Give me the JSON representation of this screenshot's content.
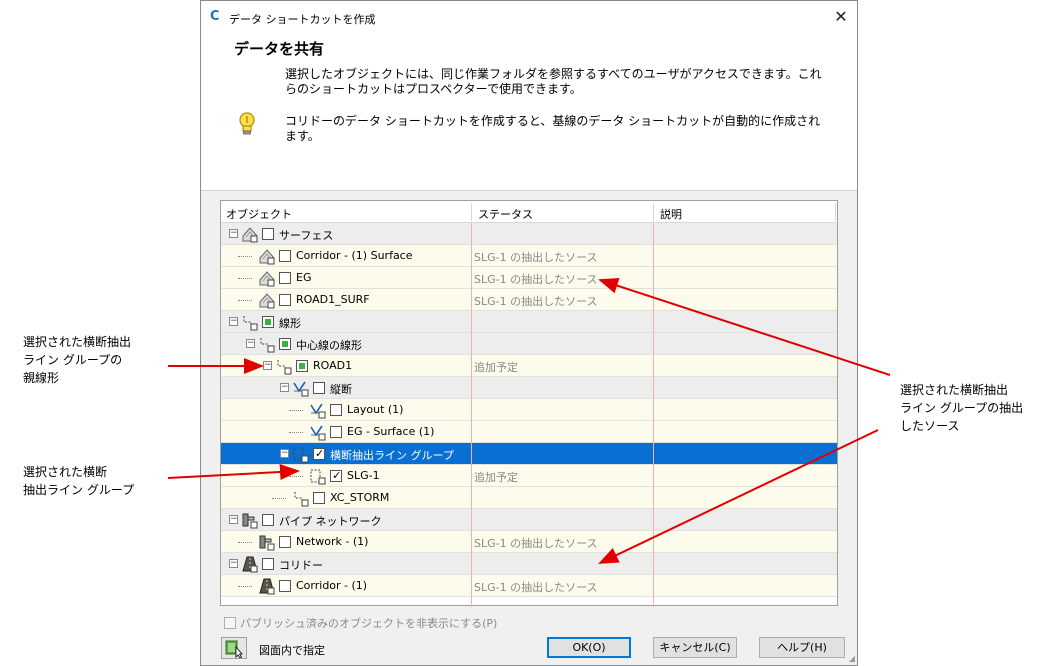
{
  "dialog": {
    "title": "データ ショートカットを作成",
    "close_glyph": "✕",
    "app_glyph": "C",
    "heading": "データを共有",
    "description": "選択したオブジェクトには、同じ作業フォルダを参照するすべてのユーザがアクセスできます。これらのショートカットはプロスペクターで使用できます。",
    "note": "コリドーのデータ ショートカットを作成すると、基線のデータ ショートカットが自動的に作成されます。",
    "icon": "lightbulb-icon"
  },
  "columns": [
    "オブジェクト",
    "ステータス",
    "説明"
  ],
  "rows": [
    {
      "label": "サーフェス",
      "status": "",
      "icon": "surface-icon"
    },
    {
      "label": "Corridor - (1) Surface",
      "status": "SLG-1 の抽出したソース",
      "icon": "surface-icon"
    },
    {
      "label": "EG",
      "status": "SLG-1 の抽出したソース",
      "icon": "surface-icon"
    },
    {
      "label": "ROAD1_SURF",
      "status": "SLG-1 の抽出したソース",
      "icon": "surface-icon"
    },
    {
      "label": "線形",
      "status": "",
      "icon": "alignment-icon"
    },
    {
      "label": "中心線の線形",
      "status": "",
      "icon": "alignment-icon"
    },
    {
      "label": "ROAD1",
      "status": "追加予定",
      "icon": "alignment-icon"
    },
    {
      "label": "縦断",
      "status": "",
      "icon": "profile-icon"
    },
    {
      "label": "Layout (1)",
      "status": "",
      "icon": "profile-icon"
    },
    {
      "label": "EG - Surface (1)",
      "status": "",
      "icon": "profile-icon"
    },
    {
      "label": "横断抽出ライン グループ",
      "status": "",
      "icon": "sample-line-group-icon"
    },
    {
      "label": "SLG-1",
      "status": "追加予定",
      "icon": "sample-line-group-icon"
    },
    {
      "label": "XC_STORM",
      "status": "",
      "icon": "alignment-icon"
    },
    {
      "label": "パイプ ネットワーク",
      "status": "",
      "icon": "pipe-network-icon"
    },
    {
      "label": "Network - (1)",
      "status": "SLG-1 の抽出したソース",
      "icon": "pipe-network-icon"
    },
    {
      "label": "コリドー",
      "status": "",
      "icon": "corridor-icon"
    },
    {
      "label": "Corridor - (1)",
      "status": "SLG-1 の抽出したソース",
      "icon": "corridor-icon"
    }
  ],
  "footer": {
    "hide_published": "パブリッシュ済みのオブジェクトを非表示にする(P)",
    "pick_label": "図面内で指定",
    "ok": "OK(O)",
    "cancel": "キャンセル(C)",
    "help": "ヘルプ(H)"
  },
  "callouts": {
    "parent_alignment": [
      "選択された横断抽出",
      "ライン グループの",
      "親線形"
    ],
    "sample_line_group": [
      "選択された横断",
      "抽出ライン グループ"
    ],
    "sources": [
      "選択された横断抽出",
      "ライン グループの抽出",
      "したソース"
    ]
  },
  "colors": {
    "selection": "#0a6fd3",
    "arrow": "#e00000",
    "group_row": "#ededed",
    "item_row": "#fdfcec"
  }
}
